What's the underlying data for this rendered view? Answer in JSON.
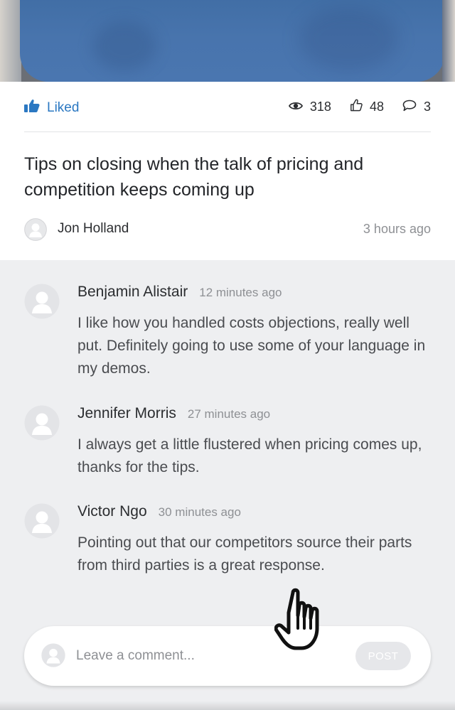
{
  "post": {
    "liked_label": "Liked",
    "views": "318",
    "likes": "48",
    "comments_count": "3",
    "title": "Tips on closing when the talk of pricing and competition keeps coming up",
    "author": "Jon Holland",
    "time": "3 hours ago"
  },
  "comments": [
    {
      "name": "Benjamin Alistair",
      "time": "12 minutes ago",
      "text": "I like how you handled costs objections, really well put. Definitely going to use some of your language in my demos."
    },
    {
      "name": "Jennifer Morris",
      "time": "27 minutes ago",
      "text": "I always get a little flustered when pricing comes up, thanks for the tips."
    },
    {
      "name": "Victor Ngo",
      "time": "30 minutes ago",
      "text": "Pointing out that our competitors source their parts from third parties is a great response."
    }
  ],
  "composer": {
    "placeholder": "Leave a comment...",
    "post_label": "POST"
  },
  "colors": {
    "accent": "#2b78c2",
    "muted_text": "#8e9094",
    "background": "#eeeff1"
  },
  "icons": {
    "liked": "thumbs-up-filled-icon",
    "views": "eye-icon",
    "likes": "thumbs-up-outline-icon",
    "comments": "speech-bubble-icon",
    "avatar": "user-placeholder-icon",
    "cursor": "hand-pointer-icon"
  }
}
